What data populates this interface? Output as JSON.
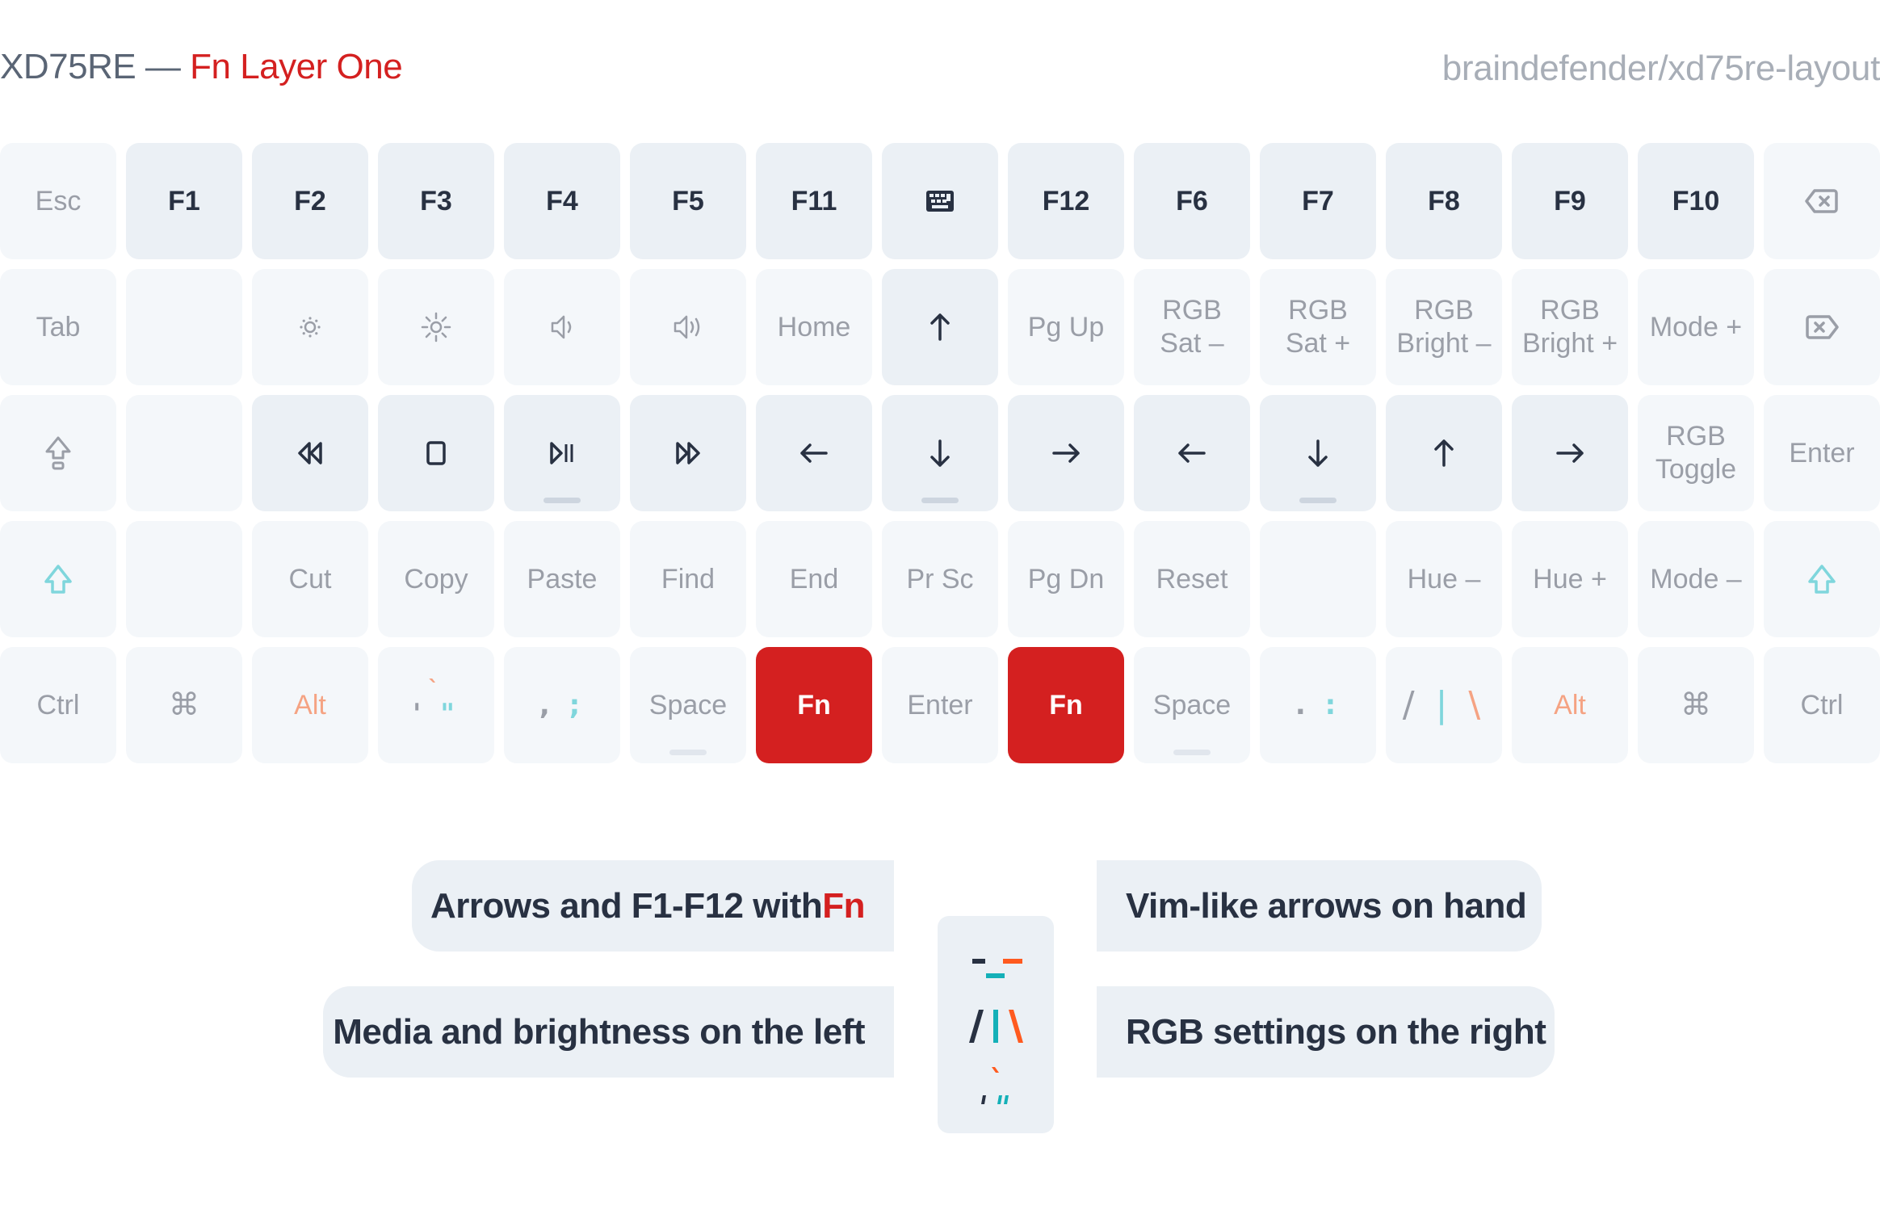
{
  "header": {
    "title_prefix": "XD75RE — ",
    "title_accent": "Fn Layer One",
    "repo": "braindefender/xd75re-layout"
  },
  "colors": {
    "accent_red": "#d42020",
    "teal": "#14b0b8",
    "orange": "#ff5a1f",
    "key_active_bg": "#ebf0f5",
    "key_transparent_bg": "#f4f7fa"
  },
  "keyboard": {
    "rows": [
      [
        {
          "label": "Esc",
          "type": "trans"
        },
        {
          "label": "F1",
          "type": "active"
        },
        {
          "label": "F2",
          "type": "active"
        },
        {
          "label": "F3",
          "type": "active"
        },
        {
          "label": "F4",
          "type": "active"
        },
        {
          "label": "F5",
          "type": "active"
        },
        {
          "label": "F11",
          "type": "active"
        },
        {
          "icon": "keyboard-icon",
          "type": "active"
        },
        {
          "label": "F12",
          "type": "active"
        },
        {
          "label": "F6",
          "type": "active"
        },
        {
          "label": "F7",
          "type": "active"
        },
        {
          "label": "F8",
          "type": "active"
        },
        {
          "label": "F9",
          "type": "active"
        },
        {
          "label": "F10",
          "type": "active"
        },
        {
          "icon": "backspace-icon",
          "type": "trans"
        }
      ],
      [
        {
          "label": "Tab",
          "type": "trans"
        },
        {
          "label": "",
          "type": "trans"
        },
        {
          "icon": "brightness-down-icon",
          "type": "trans"
        },
        {
          "icon": "brightness-up-icon",
          "type": "trans"
        },
        {
          "icon": "volume-down-icon",
          "type": "trans"
        },
        {
          "icon": "volume-up-icon",
          "type": "trans"
        },
        {
          "label": "Home",
          "type": "trans"
        },
        {
          "icon": "arrow-up-icon",
          "type": "active"
        },
        {
          "label": "Pg Up",
          "type": "trans"
        },
        {
          "label": "RGB\nSat –",
          "type": "trans"
        },
        {
          "label": "RGB\nSat +",
          "type": "trans"
        },
        {
          "label": "RGB\nBright –",
          "type": "trans"
        },
        {
          "label": "RGB\nBright +",
          "type": "trans"
        },
        {
          "label": "Mode +",
          "type": "trans"
        },
        {
          "icon": "delete-icon",
          "type": "trans"
        }
      ],
      [
        {
          "icon": "caps-lock-icon",
          "type": "trans"
        },
        {
          "label": "",
          "type": "trans"
        },
        {
          "icon": "rewind-icon",
          "type": "active"
        },
        {
          "icon": "stop-icon",
          "type": "active"
        },
        {
          "icon": "play-pause-icon",
          "type": "active",
          "bump": true
        },
        {
          "icon": "fast-forward-icon",
          "type": "active"
        },
        {
          "icon": "arrow-left-icon",
          "type": "active"
        },
        {
          "icon": "arrow-down-icon",
          "type": "active",
          "bump": true
        },
        {
          "icon": "arrow-right-icon",
          "type": "active"
        },
        {
          "icon": "arrow-left-icon",
          "type": "active"
        },
        {
          "icon": "arrow-down-icon",
          "type": "active",
          "bump": true
        },
        {
          "icon": "arrow-up-icon",
          "type": "active"
        },
        {
          "icon": "arrow-right-icon",
          "type": "active"
        },
        {
          "label": "RGB\nToggle",
          "type": "trans"
        },
        {
          "label": "Enter",
          "type": "trans"
        }
      ],
      [
        {
          "icon": "shift-icon",
          "type": "trans"
        },
        {
          "label": "",
          "type": "trans"
        },
        {
          "label": "Cut",
          "type": "trans"
        },
        {
          "label": "Copy",
          "type": "trans"
        },
        {
          "label": "Paste",
          "type": "trans"
        },
        {
          "label": "Find",
          "type": "trans"
        },
        {
          "label": "End",
          "type": "trans"
        },
        {
          "label": "Pr Sc",
          "type": "trans"
        },
        {
          "label": "Pg Dn",
          "type": "trans"
        },
        {
          "label": "Reset",
          "type": "trans"
        },
        {
          "label": "",
          "type": "trans"
        },
        {
          "label": "Hue –",
          "type": "trans"
        },
        {
          "label": "Hue +",
          "type": "trans"
        },
        {
          "label": "Mode –",
          "type": "trans"
        },
        {
          "icon": "shift-icon",
          "type": "trans"
        }
      ],
      [
        {
          "label": "Ctrl",
          "type": "trans"
        },
        {
          "label": "⌘",
          "type": "trans"
        },
        {
          "label": "Alt",
          "type": "trans",
          "color": "orange"
        },
        {
          "glyphs": [
            {
              "t": "`",
              "c": "orange"
            },
            {
              "t": "' \"",
              "c": "mixed-quote"
            }
          ],
          "type": "trans"
        },
        {
          "glyphs": [
            {
              "t": ", ;",
              "c": "mixed-semi"
            }
          ],
          "type": "trans"
        },
        {
          "label": "Space",
          "type": "trans",
          "bump": true
        },
        {
          "label": "Fn",
          "type": "fn"
        },
        {
          "label": "Enter",
          "type": "trans"
        },
        {
          "label": "Fn",
          "type": "fn"
        },
        {
          "label": "Space",
          "type": "trans",
          "bump": true
        },
        {
          "glyphs": [
            {
              "t": ". :",
              "c": "mixed-colon"
            }
          ],
          "type": "trans"
        },
        {
          "glyphs": [
            {
              "t": "/ | \\",
              "c": "mixed-slash"
            }
          ],
          "type": "trans"
        },
        {
          "label": "Alt",
          "type": "trans",
          "color": "orange"
        },
        {
          "label": "⌘",
          "type": "trans"
        },
        {
          "label": "Ctrl",
          "type": "trans"
        }
      ]
    ]
  },
  "legend": {
    "arrows": {
      "text": "Arrows and F1-F12 with ",
      "accent": "Fn"
    },
    "media": "Media and brightness on the left",
    "vim": "Vim-like arrows on hand",
    "rgb": "RGB settings on the right",
    "center_glyphs": [
      "-_-",
      "/|\\",
      "`",
      "' \""
    ]
  }
}
